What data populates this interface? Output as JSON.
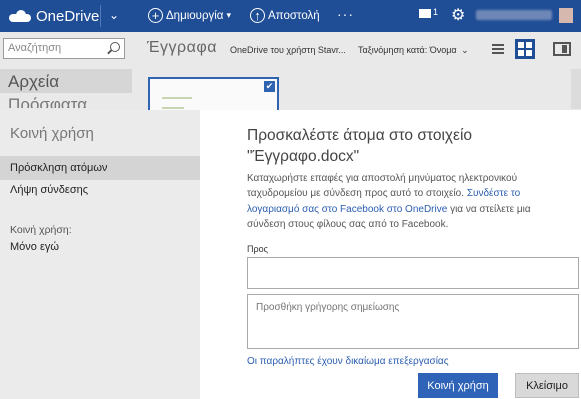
{
  "topbar": {
    "brand": "OneDrive",
    "create_label": "Δημιουργία",
    "share_label": "Αποστολή",
    "more_label": "···",
    "notification_count": "1",
    "icons": [
      "onedrive-cloud-icon",
      "chevron-down-icon",
      "plus-circle-icon",
      "upload-circle-icon",
      "more-icon",
      "message-icon",
      "gear-icon",
      "avatar"
    ]
  },
  "toolbar": {
    "search_placeholder": "Αναζήτηση",
    "breadcrumb": "Έγγραφα",
    "filter_label": "OneDrive του χρήστη Stavr...",
    "sort_label": "Ταξινόμηση κατά: Όνομα",
    "views": [
      "list-view-icon",
      "tiles-view-icon",
      "details-pane-icon"
    ]
  },
  "sidebar": {
    "files_label": "Αρχεία",
    "recent_label": "Πρόσφατα"
  },
  "share_dialog": {
    "nav_title": "Κοινή χρήση",
    "nav_items": [
      {
        "label": "Πρόσκληση ατόμων",
        "selected": true
      },
      {
        "label": "Λήψη σύνδεσης",
        "selected": false
      }
    ],
    "shared_with_label": "Κοινή χρήση:",
    "shared_with_value": "Μόνο εγώ",
    "heading_line1": "Προσκαλέστε άτομα στο στοιχείο",
    "heading_line2": "\"Έγγραφο.docx\"",
    "description_text": "Καταχωρήστε επαφές για αποστολή μηνύματος ηλεκτρονικού ταχυδρομείου με σύνδεση προς αυτό το στοιχείο.",
    "description_link": "Συνδέστε το λογαριασμό σας στο Facebook στο OneDrive",
    "description_tail": "για να στείλετε μια σύνδεση στους φίλους σας από το Facebook.",
    "to_label": "Προς",
    "to_value": "",
    "note_placeholder": "Προσθήκη γρήγορης σημείωσης",
    "permission_link": "Οι παραλήπτες έχουν δικαίωμα επεξεργασίας",
    "share_button": "Κοινή χρήση",
    "close_button": "Κλείσιμο"
  },
  "colors": {
    "topbar": "#1f4e97",
    "accent": "#2f63b8",
    "link": "#2a5db0"
  }
}
